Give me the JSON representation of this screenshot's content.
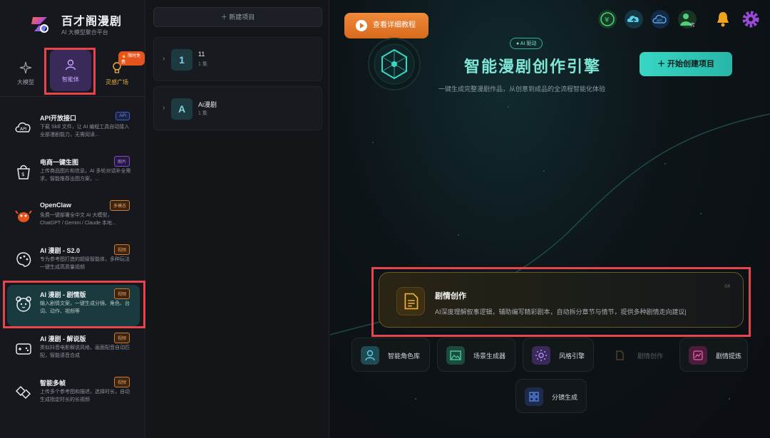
{
  "brand": {
    "title": "百才阁漫剧",
    "subtitle": "AI 大模型聚合平台"
  },
  "categories": [
    {
      "label": "大模型",
      "icon": "sparkle-icon"
    },
    {
      "label": "智能体",
      "icon": "user-icon"
    },
    {
      "label": "灵感广场",
      "icon": "lightbulb-icon"
    }
  ],
  "hot_badge": "🔥 限时免费",
  "agents": [
    {
      "name": "API开放接口",
      "badge": "API",
      "desc": "下载 Skill 文件，让 AI 编程工具自动接入全部漫剧能力，无需阅读...",
      "icon": "api-cloud-icon"
    },
    {
      "name": "电商一键生图",
      "badge": "图片",
      "desc": "上传商品图片和信息，AI 多轮对话补全需求，智能推荐出图方案，...",
      "icon": "shopping-bag-icon"
    },
    {
      "name": "OpenClaw",
      "badge": "多模态",
      "desc": "免费一键部署全中文 AI 大模型，ChatGPT / Gemini / Claude 本地...",
      "icon": "crab-icon"
    },
    {
      "name": "AI 漫剧 - S2.0",
      "badge": "视频",
      "desc": "专为参考图打造的超级智能体，多种玩法一键生成高质量视频",
      "icon": "palette-icon"
    },
    {
      "name": "AI 漫剧 - 剧情版",
      "badge": "视频",
      "desc": "输入剧情文案，一键生成分镜、角色、台词、动作、视频等",
      "icon": "bear-face-icon"
    },
    {
      "name": "AI 漫剧 - 解说版",
      "badge": "视频",
      "desc": "类似抖音电影解说风格，画面配音自动匹配，智能语音合成",
      "icon": "gamepad-icon"
    },
    {
      "name": "智能多帧",
      "badge": "视频",
      "desc": "上传多个参考图和描述，选择时长，自动生成指定时长的长视频",
      "icon": "diamond-frames-icon"
    }
  ],
  "projects": {
    "new_label": "新建项目",
    "items": [
      {
        "avatar": "1",
        "name": "11",
        "count": "1 集"
      },
      {
        "avatar": "A",
        "name": "Ai漫剧",
        "count": "1 集"
      }
    ]
  },
  "main": {
    "tutorial_label": "查看详细教程",
    "ai_tag": "AI 驱动",
    "title": "智能漫剧创作引擎",
    "subtitle": "一键生成完整漫剧作品，从创意到成品的全流程智能化体验",
    "start_label": "开始创建项目",
    "feature": {
      "title": "剧情创作",
      "desc": "AI深度理解叙事逻辑，辅助编写精彩剧本，自动拆分章节与情节，提供多种剧情走向建议|",
      "num": "04"
    },
    "tools": [
      {
        "label": "智能角色库",
        "icon": "person-icon",
        "color": "#1f4a52"
      },
      {
        "label": "场景生成器",
        "icon": "image-icon",
        "color": "#1d4a3c"
      },
      {
        "label": "风格引擎",
        "icon": "asterisk-icon",
        "color": "#3a2a5a"
      },
      {
        "label": "剧情创作",
        "icon": "document-icon",
        "color": "#2a2418"
      },
      {
        "label": "剧情提炼",
        "icon": "chart-icon",
        "color": "#4a1e3a"
      },
      {
        "label": "分镜生成",
        "icon": "grid-icon",
        "color": "#1e2a4a"
      }
    ],
    "top_icons": [
      "yuan-icon",
      "cloud-upload-icon",
      "api-cloud-icon",
      "agent-user-icon",
      "bell-icon",
      "settings-gear-icon"
    ]
  },
  "colors": {
    "accent_teal": "#39d6c4",
    "accent_orange": "#e07a28",
    "highlight_red": "#e8444c"
  }
}
